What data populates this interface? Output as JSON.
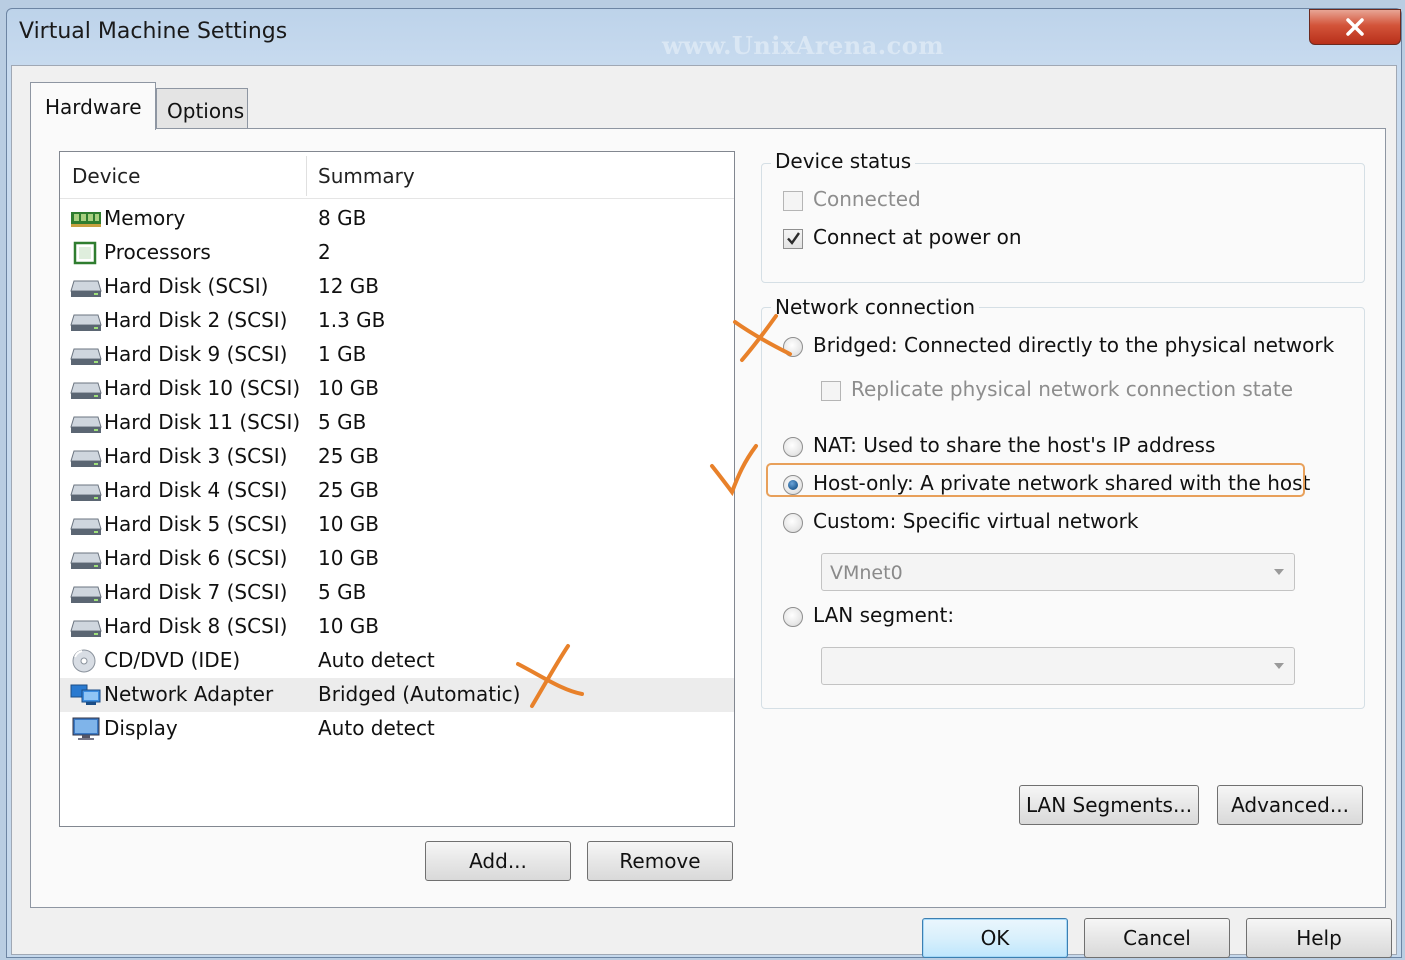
{
  "window": {
    "title": "Virtual Machine Settings",
    "watermark": "www.UnixArena.com"
  },
  "tabs": [
    {
      "label": "Hardware",
      "active": true
    },
    {
      "label": "Options",
      "active": false
    }
  ],
  "device_list": {
    "columns": [
      "Device",
      "Summary"
    ],
    "rows": [
      {
        "name": "Memory",
        "summary": "8 GB",
        "icon": "memory-icon"
      },
      {
        "name": "Processors",
        "summary": "2",
        "icon": "processor-icon"
      },
      {
        "name": "Hard Disk (SCSI)",
        "summary": "12 GB",
        "icon": "hard-disk-icon"
      },
      {
        "name": "Hard Disk 2 (SCSI)",
        "summary": "1.3 GB",
        "icon": "hard-disk-icon"
      },
      {
        "name": "Hard Disk 9 (SCSI)",
        "summary": "1 GB",
        "icon": "hard-disk-icon"
      },
      {
        "name": "Hard Disk 10 (SCSI)",
        "summary": "10 GB",
        "icon": "hard-disk-icon"
      },
      {
        "name": "Hard Disk 11 (SCSI)",
        "summary": "5 GB",
        "icon": "hard-disk-icon"
      },
      {
        "name": "Hard Disk 3 (SCSI)",
        "summary": "25 GB",
        "icon": "hard-disk-icon"
      },
      {
        "name": "Hard Disk 4 (SCSI)",
        "summary": "25 GB",
        "icon": "hard-disk-icon"
      },
      {
        "name": "Hard Disk 5 (SCSI)",
        "summary": "10 GB",
        "icon": "hard-disk-icon"
      },
      {
        "name": "Hard Disk 6 (SCSI)",
        "summary": "10 GB",
        "icon": "hard-disk-icon"
      },
      {
        "name": "Hard Disk 7 (SCSI)",
        "summary": "5 GB",
        "icon": "hard-disk-icon"
      },
      {
        "name": "Hard Disk 8 (SCSI)",
        "summary": "10 GB",
        "icon": "hard-disk-icon"
      },
      {
        "name": "CD/DVD (IDE)",
        "summary": "Auto detect",
        "icon": "cd-dvd-icon"
      },
      {
        "name": "Network Adapter",
        "summary": "Bridged (Automatic)",
        "icon": "network-adapter-icon",
        "selected": true
      },
      {
        "name": "Display",
        "summary": "Auto detect",
        "icon": "display-icon"
      }
    ],
    "add_label": "Add...",
    "remove_label": "Remove"
  },
  "device_status": {
    "title": "Device status",
    "connected": {
      "label": "Connected",
      "checked": false
    },
    "connect_power_on": {
      "label": "Connect at power on",
      "checked": true
    }
  },
  "network_connection": {
    "title": "Network connection",
    "bridged": "Bridged: Connected directly to the physical network",
    "replicate": "Replicate physical network connection state",
    "nat": "NAT: Used to share the host's IP address",
    "host_only": "Host-only: A private network shared with the host",
    "custom": "Custom: Specific virtual network",
    "custom_value": "VMnet0",
    "lan_segment": "LAN segment:",
    "lan_segment_value": "",
    "selected": "host_only"
  },
  "buttons": {
    "lan_segments": "LAN Segments...",
    "advanced": "Advanced...",
    "ok": "OK",
    "cancel": "Cancel",
    "help": "Help"
  },
  "colors": {
    "annotation": "#e8812a",
    "title_bar": "#c3d7ec",
    "close_button": "#c7452b"
  }
}
